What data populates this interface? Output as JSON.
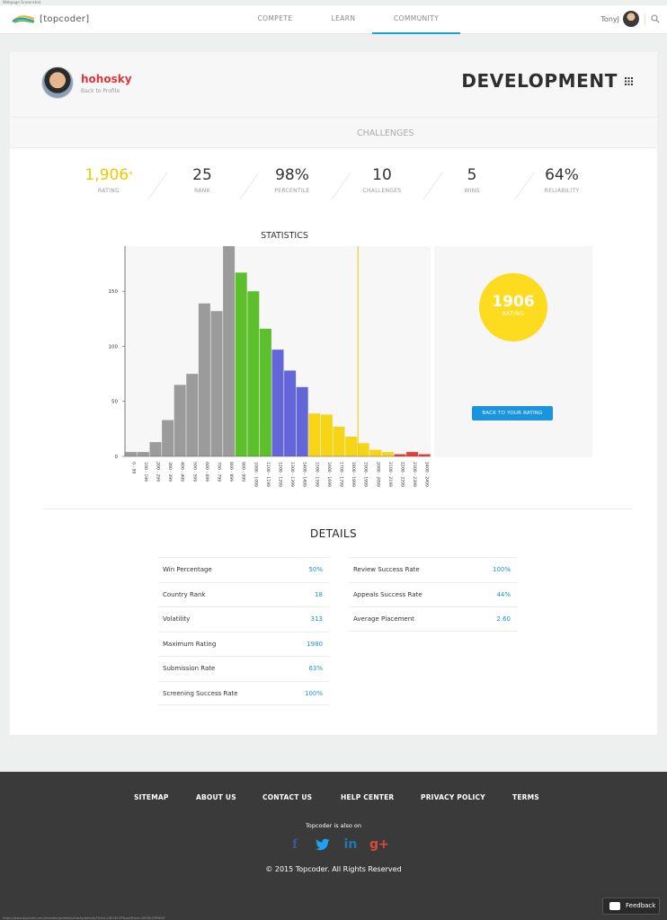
{
  "screenshot_label": "Webpage Screenshot",
  "nav": {
    "logo_text": "[topcoder]",
    "links": [
      "COMPETE",
      "LEARN",
      "COMMUNITY"
    ],
    "active": "COMMUNITY",
    "username": "TonyJ"
  },
  "profile": {
    "handle": "hohosky",
    "back_link": "Back to Profile",
    "track": "DEVELOPMENT"
  },
  "tabs": [
    "STATISTICS",
    "CHALLENGES"
  ],
  "active_tab": "STATISTICS",
  "stats": [
    {
      "value": "1,906",
      "label": "RATING"
    },
    {
      "value": "25",
      "label": "RANK"
    },
    {
      "value": "98%",
      "label": "PERCENTILE"
    },
    {
      "value": "10",
      "label": "CHALLENGES"
    },
    {
      "value": "5",
      "label": "WINS"
    },
    {
      "value": "64%",
      "label": "RELIABILITY"
    }
  ],
  "rating_star": "*",
  "chart_data": {
    "type": "bar",
    "categories": [
      "0 - 99",
      "100 - 199",
      "200 - 299",
      "300 - 399",
      "400 - 499",
      "500 - 599",
      "600 - 699",
      "700 - 799",
      "800 - 899",
      "900 - 999",
      "1000 - 1099",
      "1100 - 1199",
      "1200 - 1299",
      "1300 - 1399",
      "1400 - 1499",
      "1500 - 1599",
      "1600 - 1699",
      "1700 - 1799",
      "1800 - 1899",
      "1900 - 1999",
      "2000 - 2099",
      "2100 - 2199",
      "2200 - 2299",
      "2300 - 2399",
      "2400 - 2499"
    ],
    "values": [
      4,
      4,
      13,
      33,
      65,
      75,
      139,
      132,
      191,
      167,
      150,
      116,
      97,
      78,
      63,
      39,
      38,
      27,
      18,
      12,
      6,
      4,
      2,
      4,
      2
    ],
    "colors": [
      "#9b9b9b",
      "#9b9b9b",
      "#9b9b9b",
      "#9b9b9b",
      "#9b9b9b",
      "#9b9b9b",
      "#9b9b9b",
      "#9b9b9b",
      "#9b9b9b",
      "#5dbf2b",
      "#5dbf2b",
      "#5dbf2b",
      "#6366d8",
      "#6366d8",
      "#6366d8",
      "#f7d418",
      "#f7d418",
      "#f7d418",
      "#f7d418",
      "#f7d418",
      "#f7d418",
      "#f7d418",
      "#ea3b36",
      "#ea3b36",
      "#ea3b36"
    ],
    "yticks": [
      0,
      50,
      100,
      150
    ],
    "ylim": [
      0,
      191
    ],
    "rating_marker": 1906,
    "xlabel": "",
    "ylabel": ""
  },
  "rating_panel": {
    "rating": "1906",
    "label": "RATING",
    "button": "BACK TO YOUR RATING"
  },
  "details": {
    "title": "DETAILS",
    "left": [
      {
        "key": "Win Percentage",
        "value": "50%"
      },
      {
        "key": "Country Rank",
        "value": "18"
      },
      {
        "key": "Volatility",
        "value": "313"
      },
      {
        "key": "Maximum Rating",
        "value": "1980"
      },
      {
        "key": "Submission Rate",
        "value": "63%"
      },
      {
        "key": "Screening Success Rate",
        "value": "100%"
      }
    ],
    "right": [
      {
        "key": "Review Success Rate",
        "value": "100%"
      },
      {
        "key": "Appeals Success Rate",
        "value": "44%"
      },
      {
        "key": "Average Placement",
        "value": "2.60"
      }
    ]
  },
  "footer": {
    "links": [
      "SITEMAP",
      "ABOUT US",
      "CONTACT US",
      "HELP CENTER",
      "PRIVACY POLICY",
      "TERMS"
    ],
    "also_on": "Topcoder is also on",
    "social": [
      "f",
      "t",
      "in",
      "g+"
    ],
    "copyright": "© 2015 Topcoder. All Rights Reserved",
    "feedback": "Feedback"
  },
  "url": "https://www.topcoder.com/member/profile/hohosky/details/?track=DEVELOP&subTrack=DEVELOPMENT"
}
